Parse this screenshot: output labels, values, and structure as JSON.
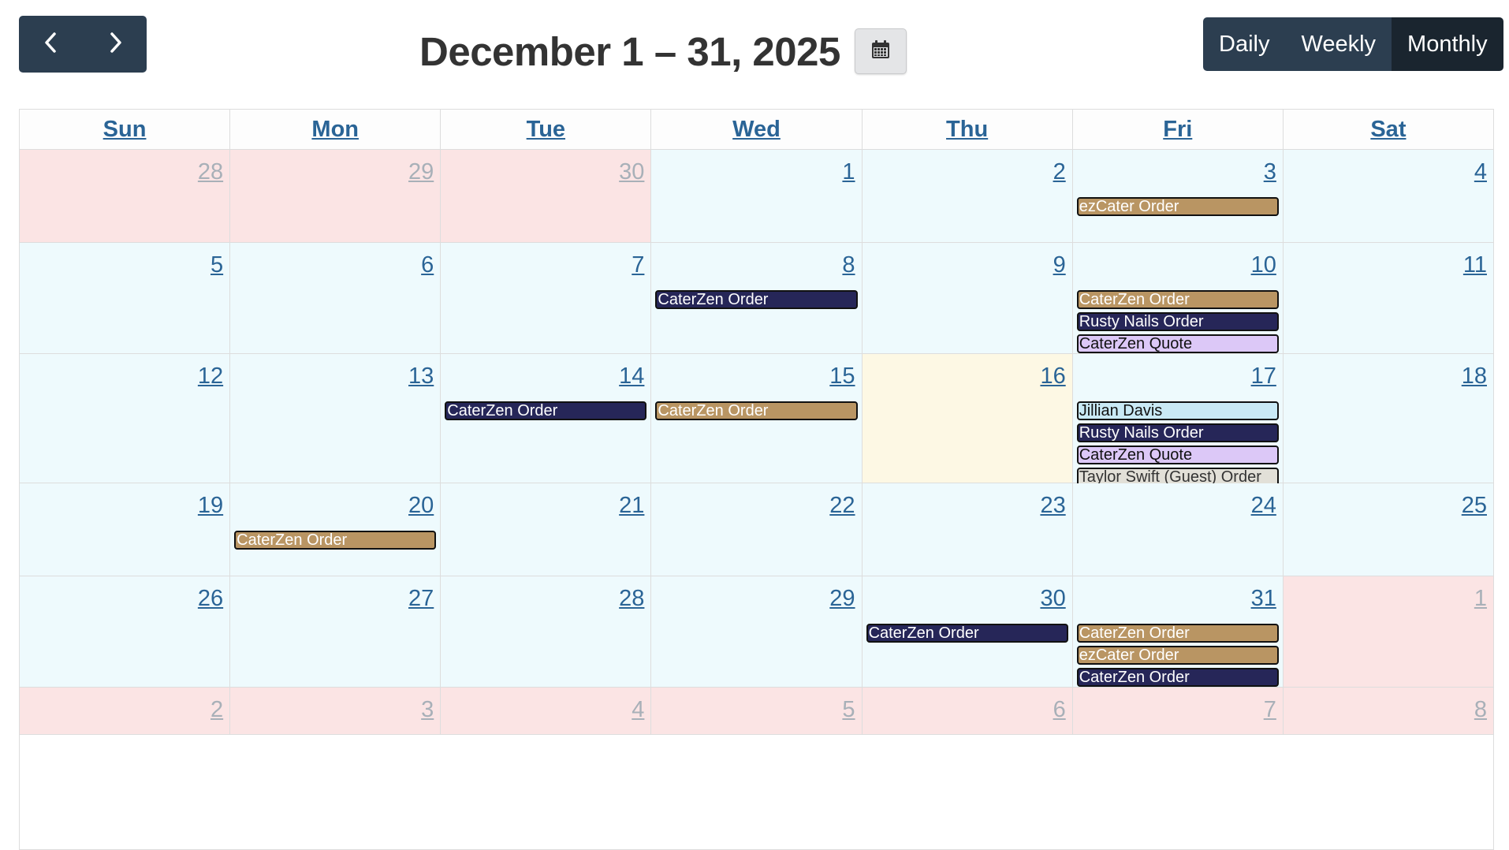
{
  "nav": {
    "prev_icon": "chevron-left-icon",
    "next_icon": "chevron-right-icon"
  },
  "header": {
    "title": "December 1 – 31, 2025",
    "calendar_icon": "calendar-icon"
  },
  "views": [
    {
      "label": "Daily",
      "active": false
    },
    {
      "label": "Weekly",
      "active": false
    },
    {
      "label": "Monthly",
      "active": true
    }
  ],
  "colors": {
    "nav_bg": "#2c3e50",
    "view_active_bg": "#1a252f",
    "link": "#2a6496",
    "cell_bg": "#eefafd",
    "other_month_bg": "#fbe4e4",
    "today_bg": "#fdf8e4",
    "event_gold": "#b99563",
    "event_navy": "#262658",
    "event_lavender": "#dcc8f7",
    "event_light": "#c9e9f5",
    "event_gray": "#e2e0d8"
  },
  "weekdays": [
    "Sun",
    "Mon",
    "Tue",
    "Wed",
    "Thu",
    "Fri",
    "Sat"
  ],
  "weeks": [
    {
      "days": [
        {
          "num": "28",
          "state": "other",
          "events": []
        },
        {
          "num": "29",
          "state": "other",
          "events": []
        },
        {
          "num": "30",
          "state": "other",
          "events": []
        },
        {
          "num": "1",
          "state": "current",
          "events": []
        },
        {
          "num": "2",
          "state": "current",
          "events": []
        },
        {
          "num": "3",
          "state": "current",
          "events": [
            {
              "title": "ezCater Order",
              "style": "gold"
            }
          ]
        },
        {
          "num": "4",
          "state": "current",
          "events": []
        }
      ]
    },
    {
      "days": [
        {
          "num": "5",
          "state": "current",
          "events": []
        },
        {
          "num": "6",
          "state": "current",
          "events": []
        },
        {
          "num": "7",
          "state": "current",
          "events": []
        },
        {
          "num": "8",
          "state": "current",
          "events": [
            {
              "title": "CaterZen Order",
              "style": "navy"
            }
          ]
        },
        {
          "num": "9",
          "state": "current",
          "events": []
        },
        {
          "num": "10",
          "state": "current",
          "events": [
            {
              "title": "CaterZen Order",
              "style": "gold"
            },
            {
              "title": "Rusty Nails Order",
              "style": "navy"
            },
            {
              "title": "CaterZen Quote",
              "style": "lav"
            }
          ]
        },
        {
          "num": "11",
          "state": "current",
          "events": []
        }
      ]
    },
    {
      "days": [
        {
          "num": "12",
          "state": "current",
          "events": []
        },
        {
          "num": "13",
          "state": "current",
          "events": []
        },
        {
          "num": "14",
          "state": "current",
          "events": [
            {
              "title": "CaterZen Order",
              "style": "navy"
            }
          ]
        },
        {
          "num": "15",
          "state": "current",
          "events": [
            {
              "title": "CaterZen Order",
              "style": "gold"
            }
          ]
        },
        {
          "num": "16",
          "state": "today",
          "events": []
        },
        {
          "num": "17",
          "state": "current",
          "events": [
            {
              "title": "Jillian Davis",
              "style": "light"
            },
            {
              "title": "Rusty Nails Order",
              "style": "navy"
            },
            {
              "title": "CaterZen Quote",
              "style": "lav"
            },
            {
              "title": "Taylor Swift (Guest) Order",
              "style": "gray"
            }
          ]
        },
        {
          "num": "18",
          "state": "current",
          "events": []
        }
      ]
    },
    {
      "days": [
        {
          "num": "19",
          "state": "current",
          "events": []
        },
        {
          "num": "20",
          "state": "current",
          "events": [
            {
              "title": "CaterZen Order",
              "style": "gold"
            }
          ]
        },
        {
          "num": "21",
          "state": "current",
          "events": []
        },
        {
          "num": "22",
          "state": "current",
          "events": []
        },
        {
          "num": "23",
          "state": "current",
          "events": []
        },
        {
          "num": "24",
          "state": "current",
          "events": []
        },
        {
          "num": "25",
          "state": "current",
          "events": []
        }
      ]
    },
    {
      "days": [
        {
          "num": "26",
          "state": "current",
          "events": []
        },
        {
          "num": "27",
          "state": "current",
          "events": []
        },
        {
          "num": "28",
          "state": "current",
          "events": []
        },
        {
          "num": "29",
          "state": "current",
          "events": []
        },
        {
          "num": "30",
          "state": "current",
          "events": [
            {
              "title": "CaterZen Order",
              "style": "navy"
            }
          ]
        },
        {
          "num": "31",
          "state": "current",
          "events": [
            {
              "title": "CaterZen Order",
              "style": "gold"
            },
            {
              "title": "ezCater Order",
              "style": "gold"
            },
            {
              "title": "CaterZen Order",
              "style": "navy"
            }
          ]
        },
        {
          "num": "1",
          "state": "other",
          "events": []
        }
      ]
    },
    {
      "days": [
        {
          "num": "2",
          "state": "other",
          "events": []
        },
        {
          "num": "3",
          "state": "other",
          "events": []
        },
        {
          "num": "4",
          "state": "other",
          "events": []
        },
        {
          "num": "5",
          "state": "other",
          "events": []
        },
        {
          "num": "6",
          "state": "other",
          "events": []
        },
        {
          "num": "7",
          "state": "other",
          "events": []
        },
        {
          "num": "8",
          "state": "other",
          "events": []
        }
      ]
    }
  ]
}
